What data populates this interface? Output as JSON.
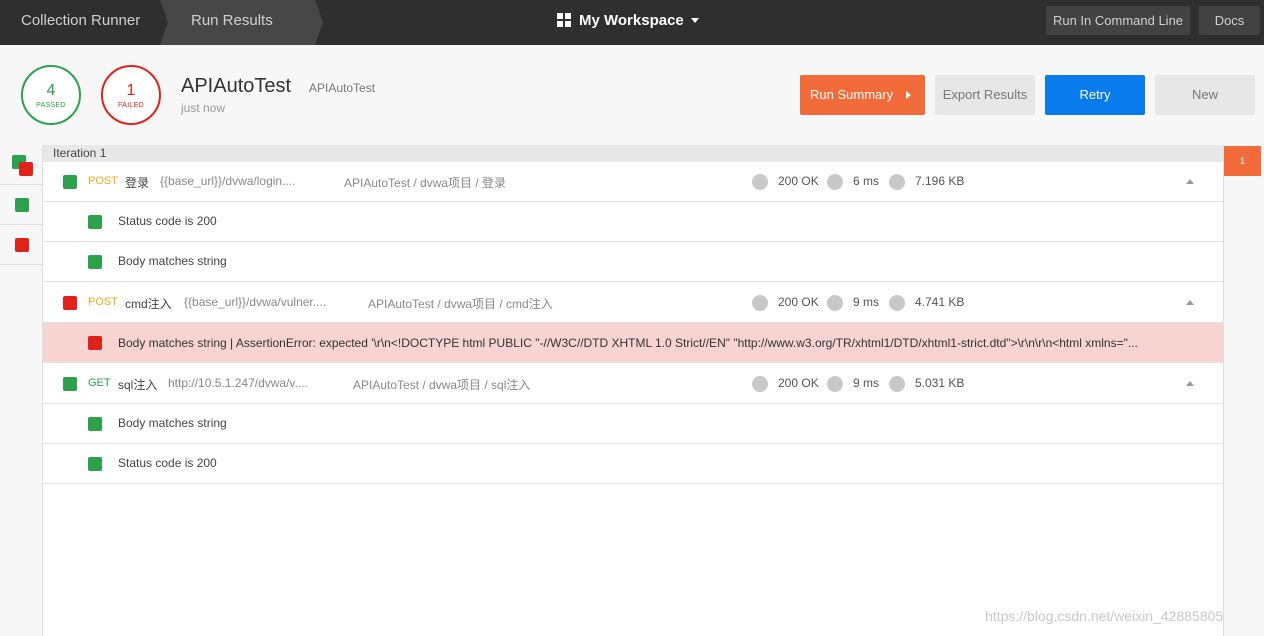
{
  "topbar": {
    "crumb1": "Collection Runner",
    "crumb2": "Run Results",
    "workspace": "My Workspace",
    "cmd_button": "Run In Command Line",
    "docs_button": "Docs"
  },
  "summary": {
    "passed_count": "4",
    "passed_label": "PASSED",
    "failed_count": "1",
    "failed_label": "FAILED",
    "title": "APIAutoTest",
    "subtitle": "APIAutoTest",
    "time": "just now"
  },
  "actions": {
    "run_summary": "Run Summary",
    "export": "Export Results",
    "retry": "Retry",
    "new": "New"
  },
  "iteration": {
    "label": "Iteration 1"
  },
  "requests": [
    {
      "method": "POST",
      "name": "登录",
      "url": "{{base_url}}/dvwa/login....",
      "path": "APIAutoTest / dvwa项目 / 登录",
      "status": "200 OK",
      "time": "6 ms",
      "size": "7.196 KB",
      "tests": [
        "Status code is 200",
        "Body matches string"
      ]
    },
    {
      "method": "POST",
      "name": "cmd注入",
      "url": "{{base_url}}/dvwa/vulner....",
      "path": "APIAutoTest / dvwa项目 / cmd注入",
      "status": "200 OK",
      "time": "9 ms",
      "size": "4.741 KB",
      "tests": [
        "Body matches string | AssertionError: expected '\\r\\n<!DOCTYPE html PUBLIC \"-//W3C//DTD XHTML 1.0 Strict//EN\" \"http://www.w3.org/TR/xhtml1/DTD/xhtml1-strict.dtd\">\\r\\n\\r\\n<html xmlns=\"..."
      ]
    },
    {
      "method": "GET",
      "name": "sql注入",
      "url": "http://10.5.1.247/dvwa/v....",
      "path": "APIAutoTest / dvwa项目 / sql注入",
      "status": "200 OK",
      "time": "9 ms",
      "size": "5.031 KB",
      "tests": [
        "Body matches string",
        "Status code is 200"
      ]
    }
  ],
  "right_rail": {
    "badge": "1"
  },
  "watermark": "https://blog.csdn.net/weixin_42885805",
  "colors": {
    "pass": "#2aa14a",
    "fail": "#e0231a",
    "accent_orange": "#f26b3a",
    "primary_blue": "#097bed"
  }
}
